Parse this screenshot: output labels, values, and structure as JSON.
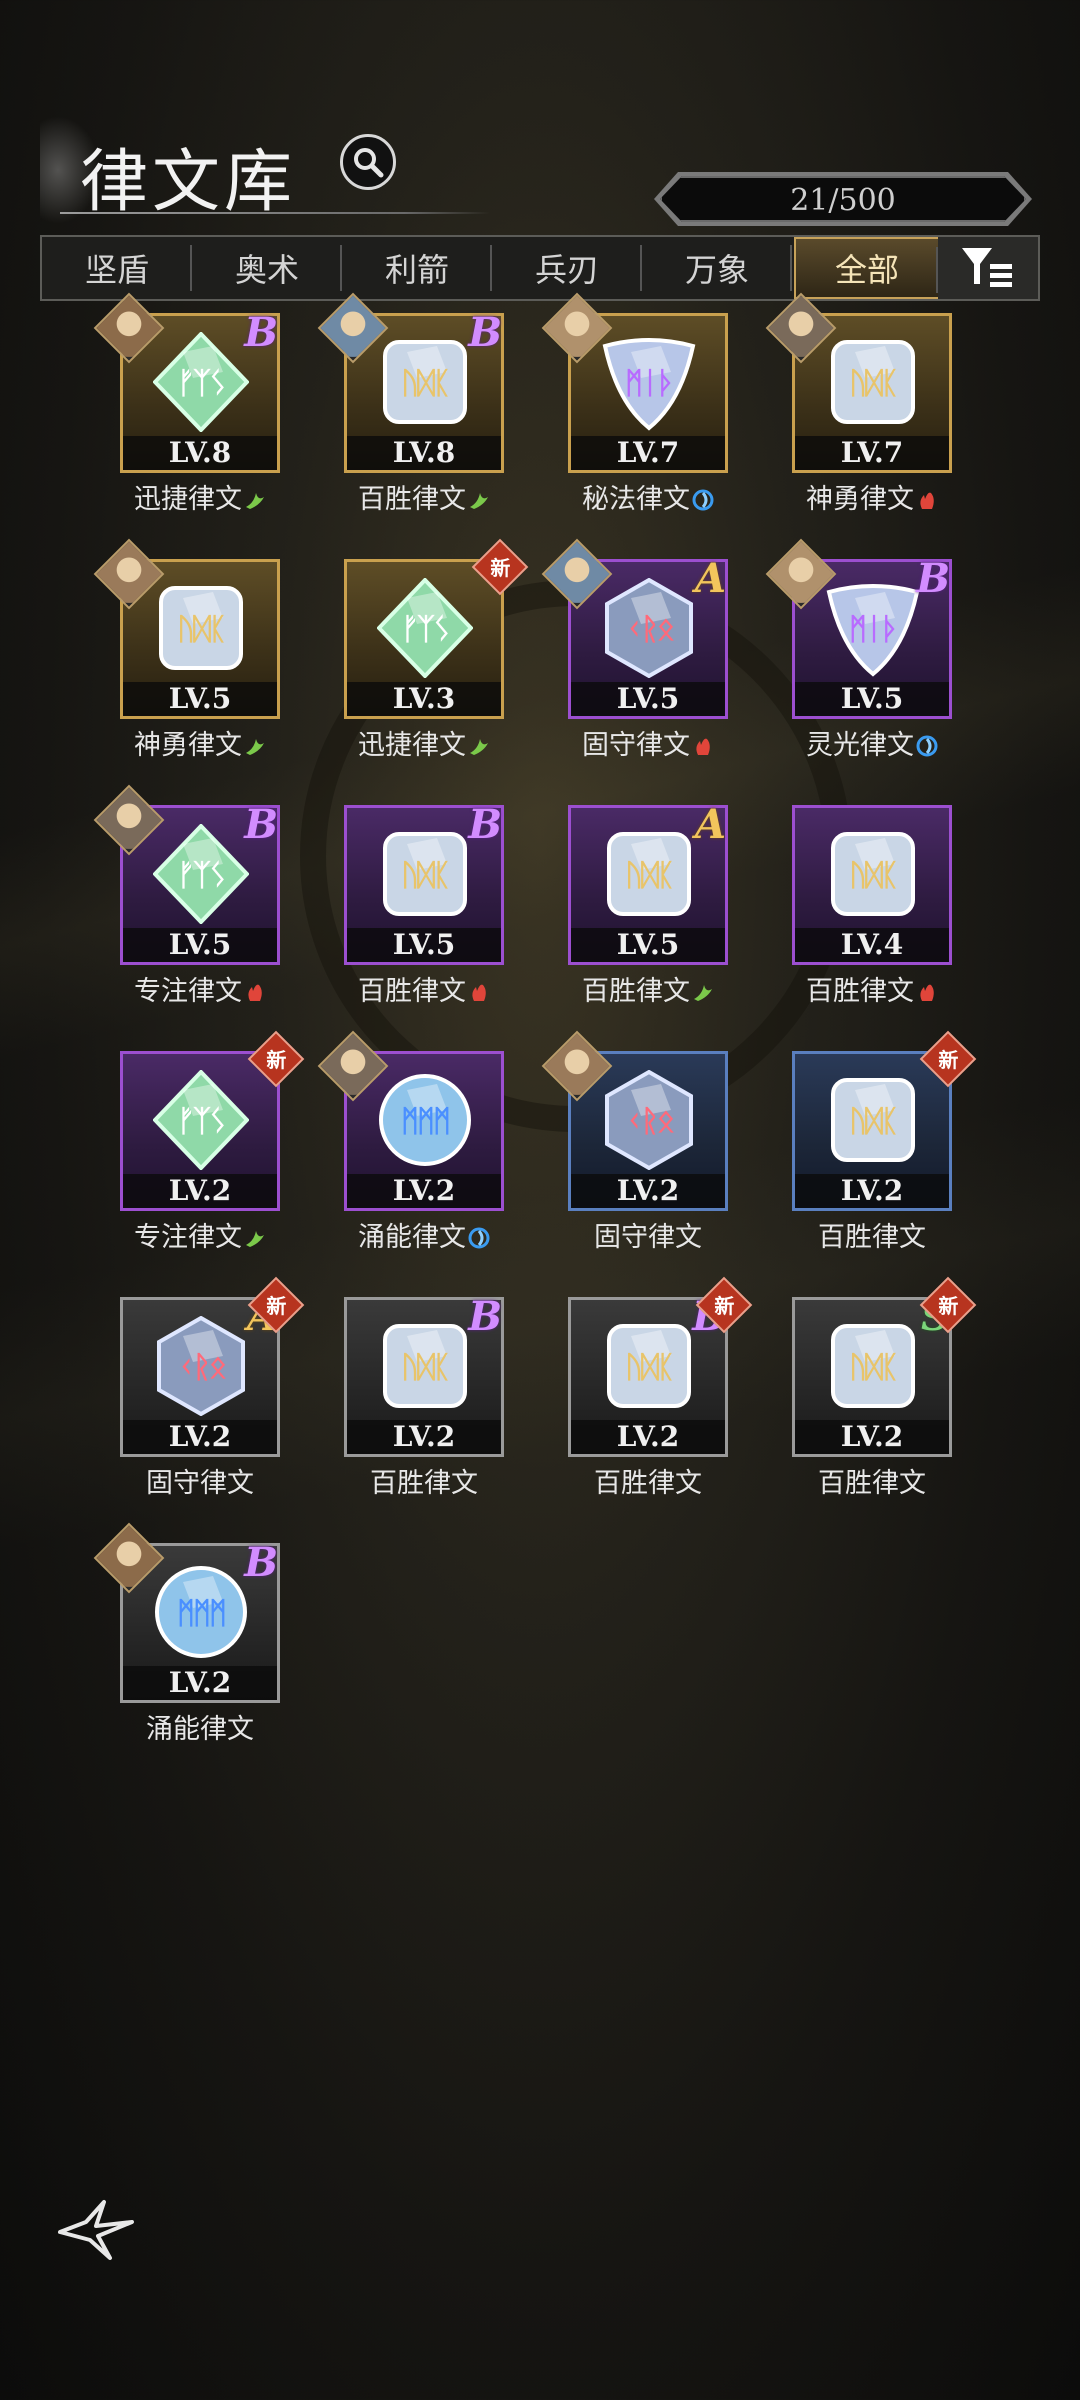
{
  "header": {
    "title": "律文库",
    "count": "21/500"
  },
  "tabs": [
    {
      "label": "坚盾",
      "active": false
    },
    {
      "label": "奥术",
      "active": false
    },
    {
      "label": "利箭",
      "active": false
    },
    {
      "label": "兵刃",
      "active": false
    },
    {
      "label": "万象",
      "active": false
    },
    {
      "label": "全部",
      "active": true
    }
  ],
  "runes": [
    {
      "name": "迅捷律文",
      "level": "LV.8",
      "rarity": "gold",
      "grade": "B",
      "is_new": false,
      "element": "wind",
      "shape": "diamond",
      "portrait": true
    },
    {
      "name": "百胜律文",
      "level": "LV.8",
      "rarity": "gold",
      "grade": "B",
      "is_new": false,
      "element": "wind",
      "shape": "square",
      "portrait": true
    },
    {
      "name": "秘法律文",
      "level": "LV.7",
      "rarity": "gold",
      "grade": "",
      "is_new": false,
      "element": "water",
      "shape": "triangle",
      "portrait": true
    },
    {
      "name": "神勇律文",
      "level": "LV.7",
      "rarity": "gold",
      "grade": "",
      "is_new": false,
      "element": "fire",
      "shape": "square",
      "portrait": true
    },
    {
      "name": "神勇律文",
      "level": "LV.5",
      "rarity": "gold",
      "grade": "",
      "is_new": false,
      "element": "wind",
      "shape": "square",
      "portrait": true
    },
    {
      "name": "迅捷律文",
      "level": "LV.3",
      "rarity": "gold",
      "grade": "",
      "is_new": true,
      "element": "wind",
      "shape": "diamond",
      "portrait": false
    },
    {
      "name": "固守律文",
      "level": "LV.5",
      "rarity": "purple",
      "grade": "A",
      "is_new": false,
      "element": "fire",
      "shape": "hex",
      "portrait": true
    },
    {
      "name": "灵光律文",
      "level": "LV.5",
      "rarity": "purple",
      "grade": "B",
      "is_new": false,
      "element": "water",
      "shape": "triangle",
      "portrait": true
    },
    {
      "name": "专注律文",
      "level": "LV.5",
      "rarity": "purple",
      "grade": "B",
      "is_new": false,
      "element": "fire",
      "shape": "diamond",
      "portrait": true
    },
    {
      "name": "百胜律文",
      "level": "LV.5",
      "rarity": "purple",
      "grade": "B",
      "is_new": false,
      "element": "fire",
      "shape": "square",
      "portrait": false
    },
    {
      "name": "百胜律文",
      "level": "LV.5",
      "rarity": "purple",
      "grade": "A",
      "is_new": false,
      "element": "wind",
      "shape": "square",
      "portrait": false
    },
    {
      "name": "百胜律文",
      "level": "LV.4",
      "rarity": "purple",
      "grade": "",
      "is_new": false,
      "element": "fire",
      "shape": "square",
      "portrait": false
    },
    {
      "name": "专注律文",
      "level": "LV.2",
      "rarity": "purple",
      "grade": "",
      "is_new": true,
      "element": "wind",
      "shape": "diamond",
      "portrait": false
    },
    {
      "name": "涌能律文",
      "level": "LV.2",
      "rarity": "purple",
      "grade": "",
      "is_new": false,
      "element": "water",
      "shape": "circle",
      "portrait": true
    },
    {
      "name": "固守律文",
      "level": "LV.2",
      "rarity": "blue",
      "grade": "",
      "is_new": false,
      "element": "",
      "shape": "hex",
      "portrait": true
    },
    {
      "name": "百胜律文",
      "level": "LV.2",
      "rarity": "blue",
      "grade": "",
      "is_new": true,
      "element": "",
      "shape": "square",
      "portrait": false
    },
    {
      "name": "固守律文",
      "level": "LV.2",
      "rarity": "gray",
      "grade": "A",
      "is_new": true,
      "element": "",
      "shape": "hex",
      "portrait": false
    },
    {
      "name": "百胜律文",
      "level": "LV.2",
      "rarity": "gray",
      "grade": "B",
      "is_new": false,
      "element": "",
      "shape": "square",
      "portrait": false
    },
    {
      "name": "百胜律文",
      "level": "LV.2",
      "rarity": "gray",
      "grade": "B",
      "is_new": true,
      "element": "",
      "shape": "square",
      "portrait": false
    },
    {
      "name": "百胜律文",
      "level": "LV.2",
      "rarity": "gray",
      "grade": "S",
      "is_new": true,
      "element": "",
      "shape": "square",
      "portrait": false
    },
    {
      "name": "涌能律文",
      "level": "LV.2",
      "rarity": "gray",
      "grade": "B",
      "is_new": false,
      "element": "",
      "shape": "circle",
      "portrait": true
    }
  ],
  "new_badge_label": "新",
  "colors": {
    "gold": "#c9a04e",
    "purple": "#9c4fd0",
    "blue": "#5a7fbf",
    "gray": "#9a9a9a"
  }
}
